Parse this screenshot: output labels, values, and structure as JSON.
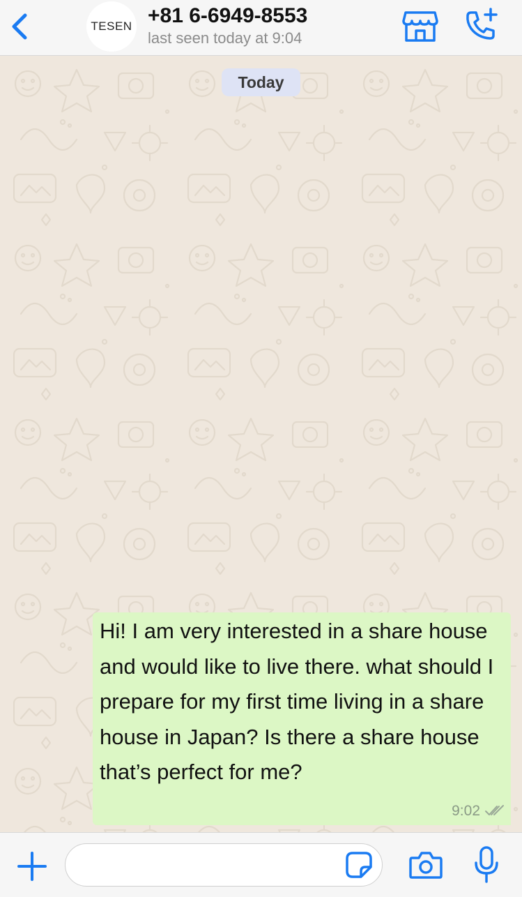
{
  "header": {
    "back_icon": "chevron-left-icon",
    "avatar_text": "TESEN",
    "contact_name": "+81 6-6949-8553",
    "status": "last seen today at 9:04",
    "actions": [
      {
        "icon": "store-icon"
      },
      {
        "icon": "phone-plus-icon"
      }
    ]
  },
  "chat": {
    "date_label": "Today",
    "messages": [
      {
        "direction": "outgoing",
        "text": "Hi! I am very interested in a share house and would like to live there. what should I prepare for my first time living in a share house in Japan? Is there a share house that’s perfect for me?",
        "time": "9:02",
        "status": "read"
      }
    ]
  },
  "input_bar": {
    "placeholder": "",
    "value": "",
    "icons": [
      "plus-icon",
      "sticker-icon",
      "camera-icon",
      "microphone-icon"
    ]
  },
  "colors": {
    "accent": "#1a7bf2",
    "bubble_outgoing": "#dcf7c5",
    "chat_background": "#efe7dd",
    "date_chip": "#dee3f5"
  }
}
